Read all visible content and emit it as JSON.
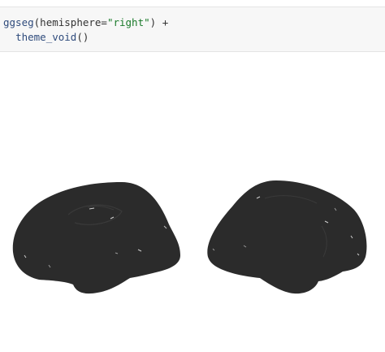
{
  "code": {
    "line1": {
      "fn": "ggseg",
      "open": "(hemisphere=",
      "arg": "\"right\"",
      "close": ") +"
    },
    "line2": {
      "indent": "  ",
      "fn": "theme_void",
      "parens": "()"
    }
  },
  "plot": {
    "views": [
      "lateral",
      "medial"
    ],
    "fill": "#2b2b2b",
    "background": "#ffffff"
  }
}
